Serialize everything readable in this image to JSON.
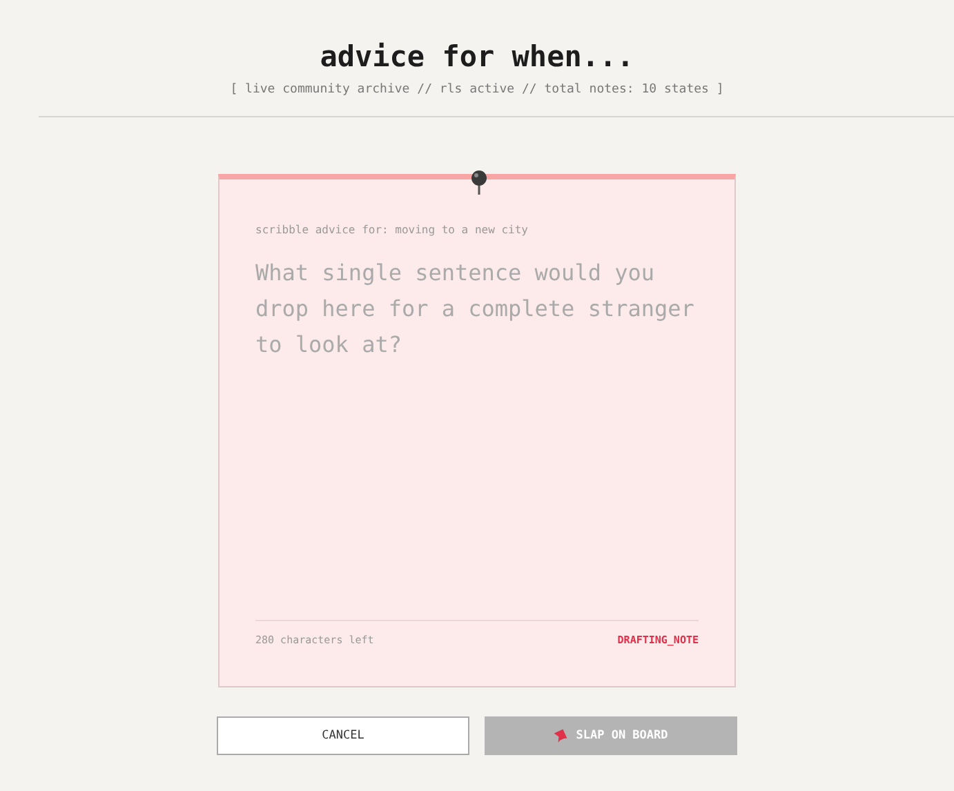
{
  "header": {
    "title": "advice for when...",
    "subtitle": "[ live community archive // rls active // total notes: 10 states ]"
  },
  "note": {
    "label": "scribble advice for: moving to a new city",
    "placeholder": "What single sentence would you drop here for a complete stranger to look at?",
    "counter": "280 characters left",
    "status": "DRAFTING_NOTE"
  },
  "buttons": [
    {
      "label": "CANCEL",
      "kind": "cancel",
      "disabled": false
    },
    {
      "label": "SLAP ON BOARD",
      "kind": "submit",
      "disabled": true
    }
  ]
}
